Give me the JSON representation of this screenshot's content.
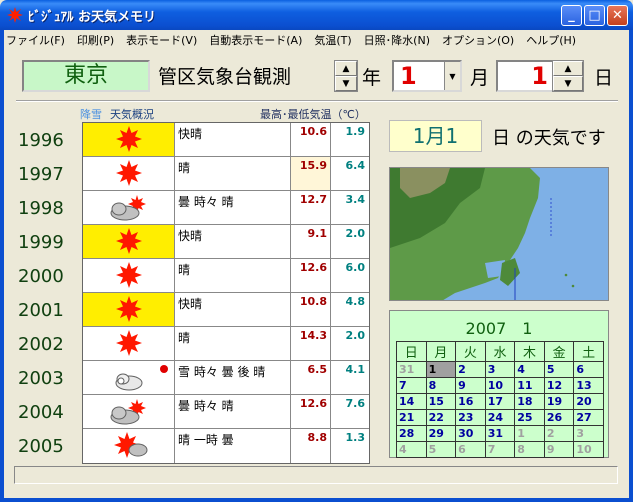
{
  "window": {
    "title": "ﾋﾞｼﾞｭｱﾙ お天気メモリ",
    "minimize": "_",
    "maximize": "□",
    "close": "✕"
  },
  "menu": [
    "ファイル(F)",
    "印刷(P)",
    "表示モード(V)",
    "自動表示モード(A)",
    "気温(T)",
    "日照･降水(N)",
    "オプション(O)",
    "ヘルプ(H)"
  ],
  "header": {
    "city": "東京",
    "observatory": "管区気象台観測",
    "year_label": "年",
    "month_value": "1",
    "month_label": "月",
    "day_value": "1",
    "day_label": "日"
  },
  "table_headers": {
    "rain_snow": "降雪",
    "summary": "天気概況",
    "temp": "最高･最低気温（℃）"
  },
  "rows": [
    {
      "year": "1996",
      "icon": "sunny",
      "desc": "快晴",
      "max": "10.6",
      "min": "1.9"
    },
    {
      "year": "1997",
      "icon": "sunny",
      "desc": "晴",
      "max": "15.9",
      "min": "6.4"
    },
    {
      "year": "1998",
      "icon": "cloudy-sunny",
      "desc": "曇 時々 晴",
      "max": "12.7",
      "min": "3.4"
    },
    {
      "year": "1999",
      "icon": "sunny",
      "desc": "快晴",
      "max": "9.1",
      "min": "2.0"
    },
    {
      "year": "2000",
      "icon": "sunny",
      "desc": "晴",
      "max": "12.6",
      "min": "6.0"
    },
    {
      "year": "2001",
      "icon": "sunny",
      "desc": "快晴",
      "max": "10.8",
      "min": "4.8"
    },
    {
      "year": "2002",
      "icon": "sunny",
      "desc": "晴",
      "max": "14.3",
      "min": "2.0"
    },
    {
      "year": "2003",
      "icon": "snow-cloud",
      "desc": "雪 時々 曇 後 晴",
      "max": "6.5",
      "min": "4.1"
    },
    {
      "year": "2004",
      "icon": "cloudy-sunny",
      "desc": "曇 時々 晴",
      "max": "12.6",
      "min": "7.6"
    },
    {
      "year": "2005",
      "icon": "sunny-cloudy",
      "desc": "晴 一時 曇",
      "max": "8.8",
      "min": "1.3"
    }
  ],
  "right": {
    "date": "1月1",
    "date_suffix": "日 の天気です",
    "calendar_title": "2007　1",
    "weekdays": [
      "日",
      "月",
      "火",
      "水",
      "木",
      "金",
      "土"
    ],
    "weeks": [
      [
        "31",
        "1",
        "2",
        "3",
        "4",
        "5",
        "6"
      ],
      [
        "7",
        "8",
        "9",
        "10",
        "11",
        "12",
        "13"
      ],
      [
        "14",
        "15",
        "16",
        "17",
        "18",
        "19",
        "20"
      ],
      [
        "21",
        "22",
        "23",
        "24",
        "25",
        "26",
        "27"
      ],
      [
        "28",
        "29",
        "30",
        "31",
        "1",
        "2",
        "3"
      ],
      [
        "4",
        "5",
        "6",
        "7",
        "8",
        "9",
        "10"
      ]
    ]
  },
  "colors": {
    "sun": "#ff1800",
    "sunny_bg": "#ffee00",
    "city_bg": "#c8f7c8",
    "calendar_bg": "#ccffcc"
  }
}
